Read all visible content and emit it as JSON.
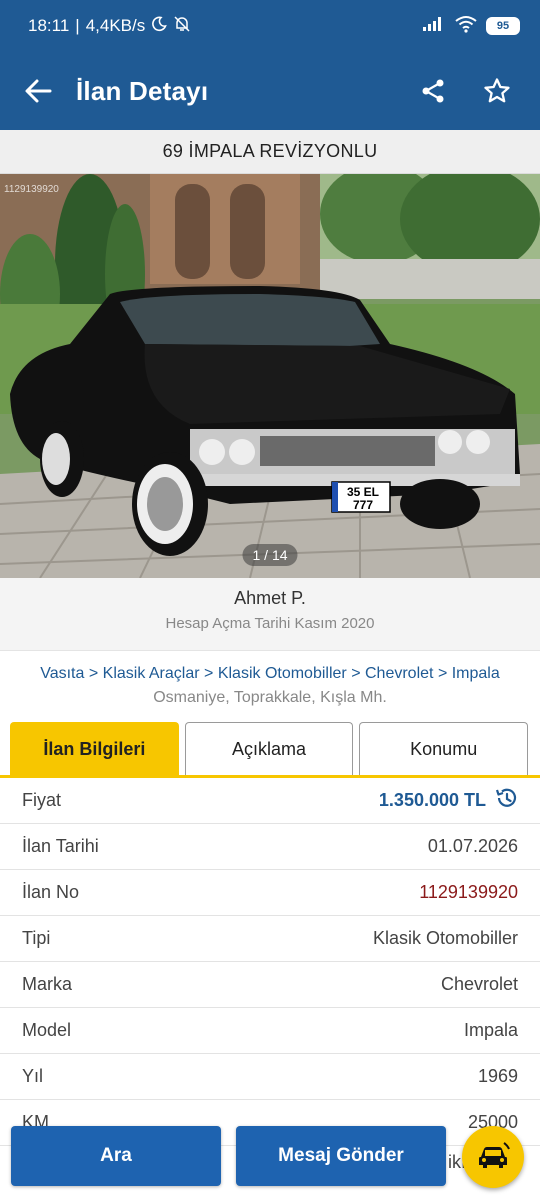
{
  "status_bar": {
    "time": "18:11",
    "network_speed": "4,4KB/s",
    "battery": "95",
    "icons": [
      "moon-icon",
      "bell-off-icon",
      "signal-icon",
      "wifi-icon",
      "battery-icon"
    ]
  },
  "app_bar": {
    "title": "İlan Detayı",
    "icons": [
      "back-arrow-icon",
      "share-icon",
      "star-icon"
    ]
  },
  "listing": {
    "title": "69 İMPALA REVİZYONLU",
    "photo": {
      "watermark": "1129139920",
      "counter": "1 / 14",
      "plate_top": "35  EL",
      "plate_bottom": "777"
    }
  },
  "seller": {
    "name": "Ahmet P.",
    "since": "Hesap Açma Tarihi Kasım 2020"
  },
  "breadcrumb": {
    "items": [
      "Vasıta",
      "Klasik Araçlar",
      "Klasik Otomobiller",
      "Chevrolet",
      "Impala"
    ],
    "separator": ">",
    "location": "Osmaniye, Toprakkale, Kışla Mh."
  },
  "tabs": [
    {
      "label": "İlan Bilgileri",
      "active": true
    },
    {
      "label": "Açıklama",
      "active": false
    },
    {
      "label": "Konumu",
      "active": false
    }
  ],
  "details": {
    "price": {
      "label": "Fiyat",
      "value": "1.350.000 TL"
    },
    "date": {
      "label": "İlan Tarihi",
      "value": "01.07.2026"
    },
    "ad_no": {
      "label": "İlan No",
      "value": "1129139920"
    },
    "type": {
      "label": "Tipi",
      "value": "Klasik Otomobiller"
    },
    "brand": {
      "label": "Marka",
      "value": "Chevrolet"
    },
    "model": {
      "label": "Model",
      "value": "Impala"
    },
    "year": {
      "label": "Yıl",
      "value": "1969"
    },
    "km": {
      "label": "KM",
      "value": "25000"
    },
    "peek": "ikı"
  },
  "actions": {
    "call": "Ara",
    "message": "Mesaj Gönder"
  },
  "colors": {
    "primary": "#1f5a94",
    "accent": "#f7c600",
    "button": "#1e63b0",
    "ad_no": "#8b1a1a"
  }
}
